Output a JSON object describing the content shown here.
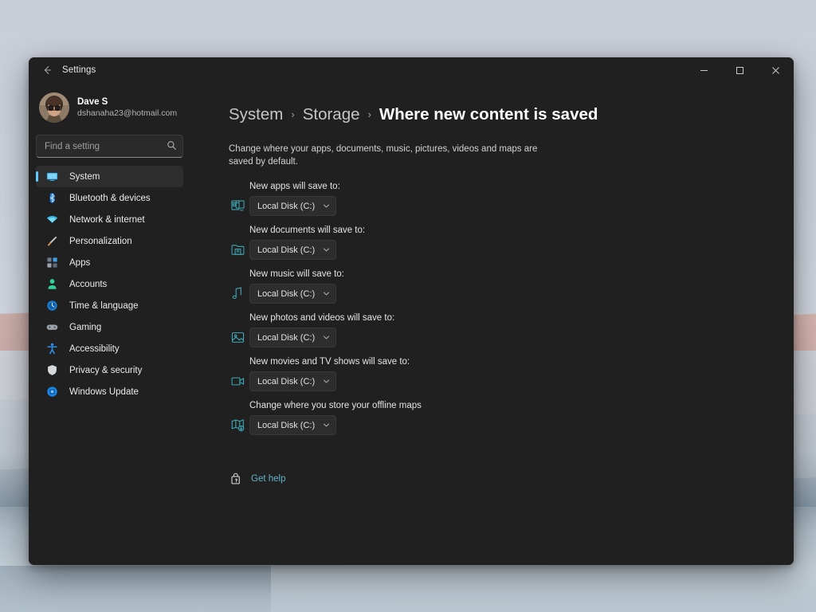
{
  "window": {
    "titlebar_title": "Settings",
    "back_icon": "back-arrow-icon",
    "minimize_icon": "minimize-icon",
    "maximize_icon": "maximize-icon",
    "close_icon": "close-icon"
  },
  "account": {
    "name": "Dave S",
    "email": "dshanaha23@hotmail.com",
    "avatar_icon": "user-avatar-photo"
  },
  "search": {
    "placeholder": "Find a setting",
    "value": "",
    "icon": "search-icon"
  },
  "sidebar": {
    "items": [
      {
        "label": "System",
        "icon": "monitor-icon",
        "active": true
      },
      {
        "label": "Bluetooth & devices",
        "icon": "bluetooth-icon",
        "active": false
      },
      {
        "label": "Network & internet",
        "icon": "wifi-icon",
        "active": false
      },
      {
        "label": "Personalization",
        "icon": "paintbrush-icon",
        "active": false
      },
      {
        "label": "Apps",
        "icon": "apps-grid-icon",
        "active": false
      },
      {
        "label": "Accounts",
        "icon": "person-icon",
        "active": false
      },
      {
        "label": "Time & language",
        "icon": "clock-icon",
        "active": false
      },
      {
        "label": "Gaming",
        "icon": "gamepad-icon",
        "active": false
      },
      {
        "label": "Accessibility",
        "icon": "accessibility-icon",
        "active": false
      },
      {
        "label": "Privacy & security",
        "icon": "shield-icon",
        "active": false
      },
      {
        "label": "Windows Update",
        "icon": "update-icon",
        "active": false
      }
    ]
  },
  "main": {
    "breadcrumb": {
      "level1": "System",
      "level2": "Storage",
      "current": "Where new content is saved",
      "separator": "›"
    },
    "description": "Change where your apps, documents, music, pictures, videos and maps are saved by default.",
    "save_locations": [
      {
        "label": "New apps will save to:",
        "value": "Local Disk (C:)",
        "icon": "app-window-icon"
      },
      {
        "label": "New documents will save to:",
        "value": "Local Disk (C:)",
        "icon": "folder-document-icon"
      },
      {
        "label": "New music will save to:",
        "value": "Local Disk (C:)",
        "icon": "music-note-icon"
      },
      {
        "label": "New photos and videos will save to:",
        "value": "Local Disk (C:)",
        "icon": "photo-icon"
      },
      {
        "label": "New movies and TV shows will save to:",
        "value": "Local Disk (C:)",
        "icon": "video-camera-icon"
      },
      {
        "label": "Change where you store your offline maps",
        "value": "Local Disk (C:)",
        "icon": "map-download-icon"
      }
    ],
    "get_help": {
      "label": "Get help",
      "icon": "help-icon"
    }
  },
  "colors": {
    "window_background": "#202020",
    "accent_blue": "#60cdff",
    "link_teal": "#62b3c9",
    "icon_teal": "#3fa8b5",
    "nav_active_bg": "#2d2d2d"
  }
}
